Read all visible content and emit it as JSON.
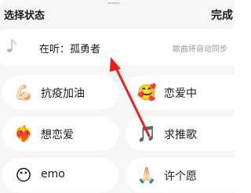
{
  "header": {
    "title": "选择状态",
    "done_label": "完成"
  },
  "song": {
    "text": "在听：孤勇者",
    "hint": "歌曲将自动同步",
    "icon": "music-note-icon"
  },
  "statuses": [
    {
      "emoji": "💪🏻",
      "label": "抗疫加油",
      "icon": "flexed-biceps-icon"
    },
    {
      "emoji": "🥰",
      "label": "恋爱中",
      "icon": "smiling-face-hearts-icon"
    },
    {
      "emoji": "❤️‍🔥",
      "label": "想恋爱",
      "icon": "heart-on-fire-icon"
    },
    {
      "emoji": "🎵",
      "label": "求推歌",
      "icon": "musical-note-icon"
    },
    {
      "emoji": "😶",
      "label": "emo",
      "icon": "face-without-mouth-icon"
    },
    {
      "emoji": "🙏🏻",
      "label": "许个愿",
      "icon": "folded-hands-icon"
    }
  ],
  "colors": {
    "sheet_background": "#f7f6f5",
    "card_background": "#ffffff",
    "annotation_arrow": "#e8211d"
  }
}
